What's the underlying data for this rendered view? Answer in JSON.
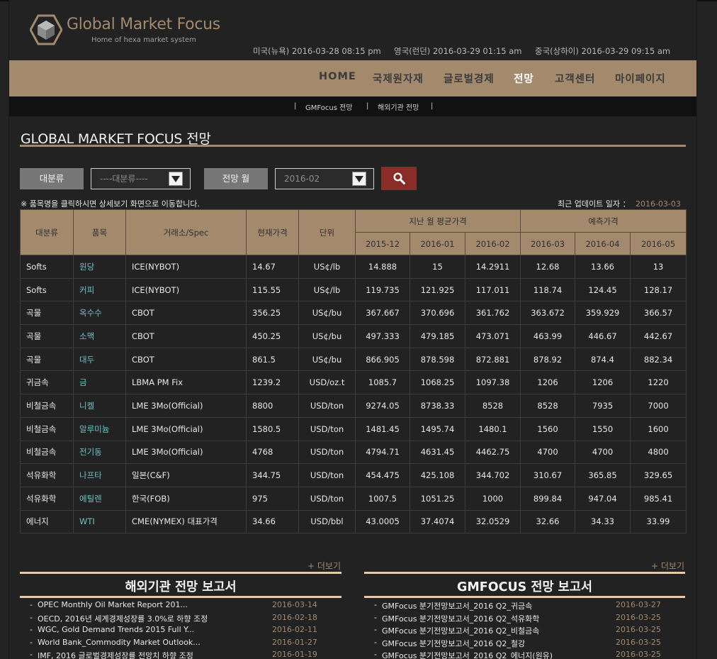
{
  "brand": {
    "name": "Global Market Focus",
    "tagline": "Home of hexa market system"
  },
  "clocks": [
    {
      "label": "미국(뉴욕) 2016-03-28 08:15 pm"
    },
    {
      "label": "영국(런던) 2016-03-29 01:15 am"
    },
    {
      "label": "중국(상하이) 2016-03-29 09:15 am"
    }
  ],
  "nav": {
    "items": [
      "HOME",
      "국제원자재",
      "글로벌경제",
      "전망",
      "고객센터",
      "마이페이지"
    ],
    "active": "전망"
  },
  "subnav": {
    "items": [
      "GMFocus 전망",
      "해외기관 전망"
    ]
  },
  "page": {
    "title": "GLOBAL MARKET FOCUS 전망"
  },
  "filters": {
    "category_label": "대분류",
    "category_value": "----대분류----",
    "month_label": "전망 월",
    "month_value": "2016-02"
  },
  "notice": "※ 품목명을 클릭하시면 상세보기 화면으로 이동합니다.",
  "update": {
    "label": "최근 업데이트 일자 ：",
    "date": "2016-03-03"
  },
  "table": {
    "headers": {
      "category": "대분류",
      "item": "품목",
      "exchange": "거래소/Spec",
      "current": "현재가격",
      "unit": "단위",
      "past_group": "지난 월 평균가격",
      "forecast_group": "예측가격",
      "past_months": [
        "2015-12",
        "2016-01",
        "2016-02"
      ],
      "forecast_months": [
        "2016-03",
        "2016-04",
        "2016-05"
      ]
    },
    "rows": [
      [
        "Softs",
        "원당",
        "ICE(NYBOT)",
        "14.67",
        "US¢/lb",
        "14.888",
        "15",
        "14.2911",
        "12.68",
        "13.66",
        "13"
      ],
      [
        "Softs",
        "커피",
        "ICE(NYBOT)",
        "115.55",
        "US¢/lb",
        "119.735",
        "121.925",
        "117.011",
        "118.74",
        "124.45",
        "128.17"
      ],
      [
        "곡물",
        "옥수수",
        "CBOT",
        "356.25",
        "US¢/bu",
        "367.667",
        "370.696",
        "361.762",
        "363.672",
        "359.929",
        "366.57"
      ],
      [
        "곡물",
        "소맥",
        "CBOT",
        "450.25",
        "US¢/bu",
        "497.333",
        "479.185",
        "473.071",
        "463.99",
        "446.67",
        "442.67"
      ],
      [
        "곡물",
        "대두",
        "CBOT",
        "861.5",
        "US¢/bu",
        "866.905",
        "878.598",
        "872.881",
        "878.92",
        "874.4",
        "882.34"
      ],
      [
        "귀금속",
        "금",
        "LBMA PM Fix",
        "1239.2",
        "USD/oz.t",
        "1085.7",
        "1068.25",
        "1097.38",
        "1206",
        "1206",
        "1220"
      ],
      [
        "비철금속",
        "니켈",
        "LME 3Mo(Official)",
        "8800",
        "USD/ton",
        "9274.05",
        "8738.33",
        "8528",
        "8528",
        "7935",
        "7000"
      ],
      [
        "비철금속",
        "알루미늄",
        "LME 3Mo(Official)",
        "1580.5",
        "USD/ton",
        "1481.45",
        "1495.74",
        "1480.1",
        "1560",
        "1550",
        "1600"
      ],
      [
        "비철금속",
        "전기동",
        "LME 3Mo(Official)",
        "4768",
        "USD/ton",
        "4794.71",
        "4631.45",
        "4462.75",
        "4700",
        "4700",
        "4800"
      ],
      [
        "석유화학",
        "나프타",
        "일본(C&F)",
        "344.75",
        "USD/ton",
        "454.475",
        "425.108",
        "344.702",
        "310.67",
        "365.85",
        "329.65"
      ],
      [
        "석유화학",
        "에틸렌",
        "한국(FOB)",
        "975",
        "USD/ton",
        "1007.5",
        "1051.25",
        "1000",
        "899.84",
        "947.04",
        "985.41"
      ],
      [
        "에너지",
        "WTI",
        "CME(NYMEX) 대표가격",
        "34.66",
        "USD/bbl",
        "43.0005",
        "37.4074",
        "32.0529",
        "32.66",
        "34.33",
        "33.99"
      ]
    ]
  },
  "reports": {
    "more_label": "+ 더보기",
    "foreign": {
      "title": "해외기관 전망 보고서",
      "items": [
        {
          "text": "OPEC Monthly Oil Market Report 201...",
          "date": "2016-03-14"
        },
        {
          "text": "OECD, 2016년 세계경제성장률 3.0%로 하향 조정",
          "date": "2016-02-18"
        },
        {
          "text": "WGC, Gold Demand Trends 2015 Full Y...",
          "date": "2016-02-11"
        },
        {
          "text": "World Bank_Commodity Market Outlook...",
          "date": "2016-01-27"
        },
        {
          "text": "IMF, 2016 글로벌경제성장률 전망치 하향 조정",
          "date": "2016-01-19"
        }
      ]
    },
    "gmfocus": {
      "title": "GMFOCUS 전망 보고서",
      "items": [
        {
          "text": "GMFocus 분기전망보고서_2016 Q2_귀금속",
          "date": "2016-03-27"
        },
        {
          "text": "GMFocus 분기전망보고서_2016 Q2_석유화학",
          "date": "2016-03-25"
        },
        {
          "text": "GMFocus 분기전망보고서_2016 Q2_비철금속",
          "date": "2016-03-25"
        },
        {
          "text": "GMFocus 분기전망보고서_2016 Q2_철강",
          "date": "2016-03-25"
        },
        {
          "text": "GMFocus 분기전망보고서_2016 Q2_에너지(원유)",
          "date": "2016-03-25"
        }
      ]
    }
  },
  "colors": {
    "accent": "#a38a6d",
    "link": "#6cc0c8",
    "search_button": "#8a2d28"
  }
}
